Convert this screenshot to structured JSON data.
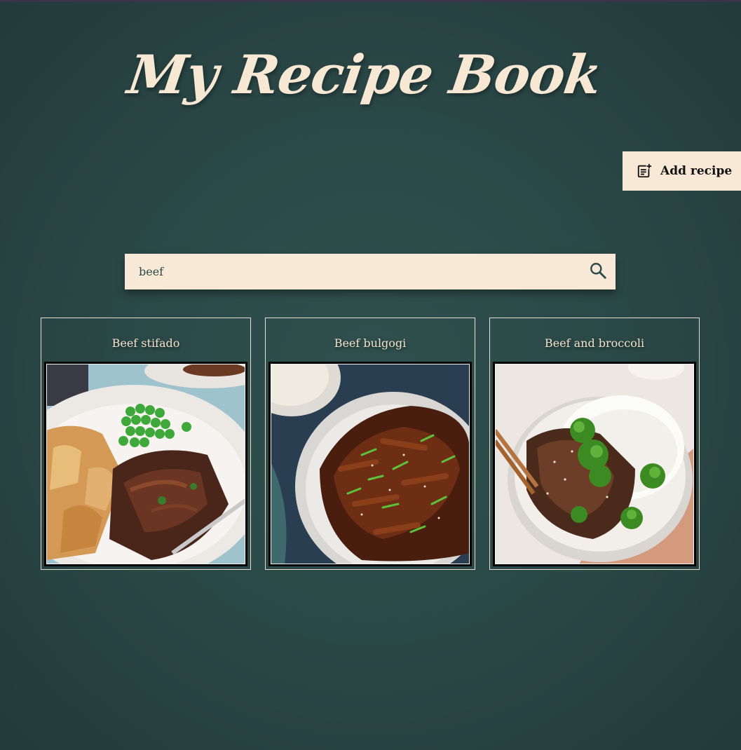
{
  "header": {
    "title": "My Recipe Book"
  },
  "toolbar": {
    "add_recipe_label": "Add recipe",
    "add_recipe_icon": "note-add-icon"
  },
  "search": {
    "value": "beef",
    "icon": "search-icon"
  },
  "recipes": [
    {
      "title": "Beef stifado",
      "image": "beef-stifado-photo"
    },
    {
      "title": "Beef bulgogi",
      "image": "beef-bulgogi-photo"
    },
    {
      "title": "Beef and broccoli",
      "image": "beef-and-broccoli-photo"
    }
  ],
  "colors": {
    "background": "#2b4948",
    "accent": "#f8e9d6",
    "title_text": "#f7e8d4"
  }
}
